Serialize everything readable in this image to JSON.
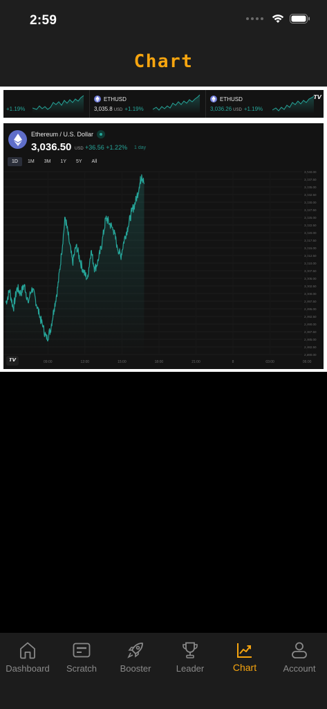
{
  "status": {
    "time": "2:59"
  },
  "header": {
    "title": "Chart"
  },
  "ticker": {
    "items": [
      {
        "symbol": "",
        "price": "",
        "unit": "",
        "change": "+1.19%"
      },
      {
        "symbol": "ETHUSD",
        "price": "3,035.8",
        "unit": "USD",
        "change": "+1.19%"
      },
      {
        "symbol": "ETHUSD",
        "price": "3,036.26",
        "unit": "USD",
        "change": "+1.19%"
      }
    ]
  },
  "chart": {
    "pair": "Ethereum / U.S. Dollar",
    "price": "3,036.50",
    "unit": "USD",
    "change": "+36.56",
    "change_pct": "+1.22%",
    "period": "1 day",
    "ranges": [
      "1D",
      "1M",
      "3M",
      "1Y",
      "5Y",
      "All"
    ],
    "active_range": "1D",
    "line_color": "#26a69a",
    "background": "#131313"
  },
  "chart_data": {
    "type": "line",
    "title": "Ethereum / U.S. Dollar",
    "x_ticks": [
      "09:00",
      "12:00",
      "15:00",
      "18:00",
      "21:00",
      "8",
      "03:00",
      "06:00"
    ],
    "y_ticks": [
      2980.0,
      2982.5,
      2985.0,
      2987.5,
      2990.0,
      2992.5,
      2995.0,
      2997.5,
      3000.0,
      3002.5,
      3005.0,
      3007.5,
      3010.0,
      3012.5,
      3015.0,
      3017.5,
      3020.0,
      3022.5,
      3025.0,
      3027.5,
      3030.0,
      3032.5,
      3035.0,
      3037.5,
      3040.0
    ],
    "ylim": [
      2980,
      3040
    ],
    "xlim": [
      5.4,
      29.6
    ],
    "series": [
      {
        "values": [
          [
            5.6,
            2997
          ],
          [
            5.9,
            3001
          ],
          [
            6.2,
            2995
          ],
          [
            6.5,
            3002
          ],
          [
            6.8,
            3000
          ],
          [
            7.1,
            3003
          ],
          [
            7.4,
            2997
          ],
          [
            7.7,
            3002
          ],
          [
            8.0,
            2998
          ],
          [
            8.3,
            2993
          ],
          [
            8.6,
            2989
          ],
          [
            8.9,
            2985
          ],
          [
            9.2,
            2988
          ],
          [
            9.5,
            2995
          ],
          [
            9.8,
            3002
          ],
          [
            10.1,
            3013
          ],
          [
            10.4,
            3025
          ],
          [
            10.7,
            3018
          ],
          [
            11.0,
            3010
          ],
          [
            11.3,
            3016
          ],
          [
            11.6,
            3011
          ],
          [
            11.9,
            3007
          ],
          [
            12.2,
            3005
          ],
          [
            12.5,
            3014
          ],
          [
            12.8,
            3008
          ],
          [
            13.1,
            3011
          ],
          [
            13.4,
            3017
          ],
          [
            13.7,
            3025
          ],
          [
            14.0,
            3023
          ],
          [
            14.3,
            3021
          ],
          [
            14.6,
            3016
          ],
          [
            14.9,
            3012
          ],
          [
            15.2,
            3018
          ],
          [
            15.5,
            3022
          ],
          [
            15.8,
            3027
          ],
          [
            16.1,
            3030
          ],
          [
            16.4,
            3035
          ],
          [
            16.6,
            3039
          ],
          [
            16.8,
            3036
          ]
        ]
      }
    ],
    "grid": true
  },
  "nav": {
    "items": [
      {
        "label": "Dashboard",
        "icon": "home-icon"
      },
      {
        "label": "Scratch",
        "icon": "card-icon"
      },
      {
        "label": "Booster",
        "icon": "rocket-icon"
      },
      {
        "label": "Leader",
        "icon": "trophy-icon"
      },
      {
        "label": "Chart",
        "icon": "chart-trend-icon"
      },
      {
        "label": "Account",
        "icon": "user-icon"
      }
    ],
    "active": "Chart",
    "active_color": "#f7a50f"
  }
}
